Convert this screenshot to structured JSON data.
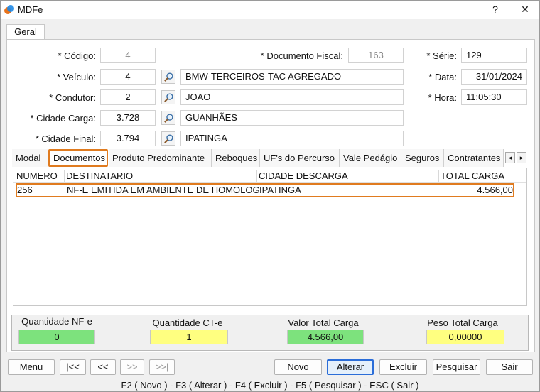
{
  "window": {
    "title": "MDFe",
    "help_label": "?",
    "close_label": "✕"
  },
  "main_tab": "Geral",
  "form": {
    "codigo": {
      "label": "* Código:",
      "value": "4"
    },
    "documento_fiscal": {
      "label": "* Documento Fiscal:",
      "value": "163"
    },
    "serie": {
      "label": "* Série:",
      "value": "129"
    },
    "veiculo": {
      "label": "* Veículo:",
      "value": "4",
      "description": "BMW-TERCEIROS-TAC AGREGADO"
    },
    "data": {
      "label": "* Data:",
      "value": "31/01/2024"
    },
    "condutor": {
      "label": "* Condutor:",
      "value": "2",
      "description": "JOAO"
    },
    "hora": {
      "label": "* Hora:",
      "value": "11:05:30"
    },
    "cidade_carga": {
      "label": "* Cidade Carga:",
      "value": "3.728",
      "description": "GUANHÃES"
    },
    "cidade_final": {
      "label": "* Cidade Final:",
      "value": "3.794",
      "description": "IPATINGA"
    }
  },
  "tabs": [
    {
      "label": "Modal"
    },
    {
      "label": "Documentos"
    },
    {
      "label": "Produto Predominante"
    },
    {
      "label": "Reboques"
    },
    {
      "label": "UF's do Percurso"
    },
    {
      "label": "Vale Pedágio"
    },
    {
      "label": "Seguros"
    },
    {
      "label": "Contratantes"
    }
  ],
  "grid": {
    "columns": [
      "NUMERO",
      "DESTINATARIO",
      "CIDADE DESCARGA",
      "TOTAL CARGA"
    ],
    "rows": [
      {
        "numero": "256",
        "destinatario": "NF-E EMITIDA EM AMBIENTE DE HOMOLOGAÇÃO",
        "cidade": "IPATINGA",
        "total": "4.566,00"
      }
    ]
  },
  "totals": {
    "qtd_nfe": {
      "label": "Quantidade NF-e",
      "value": "0"
    },
    "qtd_cte": {
      "label": "Quantidade CT-e",
      "value": "1"
    },
    "valor_total": {
      "label": "Valor Total Carga",
      "value": "4.566,00"
    },
    "peso_total": {
      "label": "Peso Total Carga",
      "value": "0,00000"
    }
  },
  "buttons": {
    "menu": "Menu",
    "first": "|<<",
    "prev": "<<",
    "next": ">>",
    "last": ">>|",
    "novo": "Novo",
    "alterar": "Alterar",
    "excluir": "Excluir",
    "pesquisar": "Pesquisar",
    "sair": "Sair"
  },
  "shortcuts": "F2 ( Novo )  -  F3 ( Alterar )  -  F4 ( Excluir )  -  F5 ( Pesquisar )  -  ESC ( Sair )",
  "colors": {
    "accent": "#e07b1f",
    "green": "#7de27d",
    "yellow": "#ffff80",
    "focus": "#2b6dd8"
  }
}
